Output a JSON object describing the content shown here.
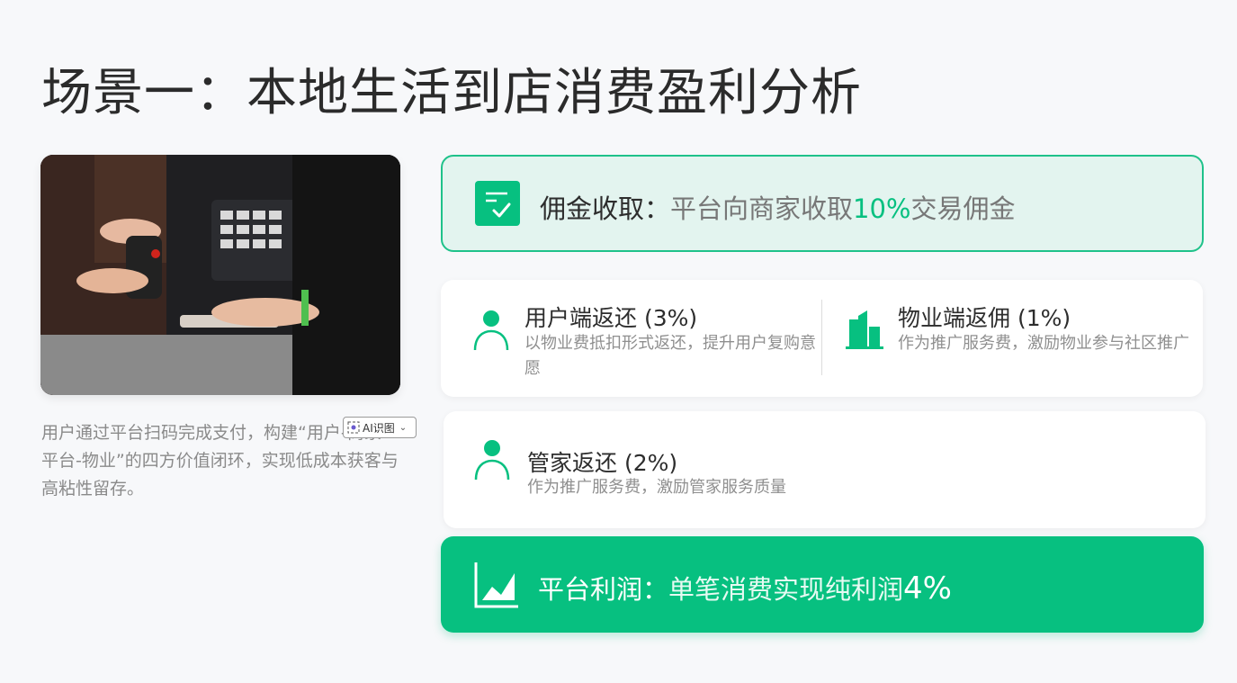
{
  "page": {
    "title": "场景一：本地生活到店消费盈利分析"
  },
  "left": {
    "photo_icon": "payment-scan-photo",
    "description": "用户通过平台扫码完成支付，构建“用户-商家-平台-物业”的四方价值闭环，实现低成本获客与高粘性留存。",
    "ai_badge": {
      "label": "AI识图",
      "icon": "ai-recognize-icon"
    }
  },
  "commission": {
    "icon": "checklist-icon",
    "label": "佣金收取：",
    "text_before": "平台向商家收取",
    "highlight": "10%",
    "text_after": "交易佣金"
  },
  "rebates": {
    "user": {
      "icon": "person-icon",
      "title": "用户端返还 (3%)",
      "desc": "以物业费抵扣形式返还，提升用户复购意愿"
    },
    "property": {
      "icon": "building-icon",
      "title": "物业端返佣 (1%)",
      "desc": "作为推广服务费，激励物业参与社区推广"
    }
  },
  "butler": {
    "icon": "person-icon",
    "title": "管家返还 (2%)",
    "desc": "作为推广服务费，激励管家服务质量"
  },
  "profit": {
    "icon": "area-chart-icon",
    "label": "平台利润：",
    "text_before": "单笔消费实现纯利润",
    "highlight": "4%"
  },
  "colors": {
    "accent": "#07c080",
    "accent_light": "#e3f4ef",
    "background": "#f7f8fa"
  }
}
